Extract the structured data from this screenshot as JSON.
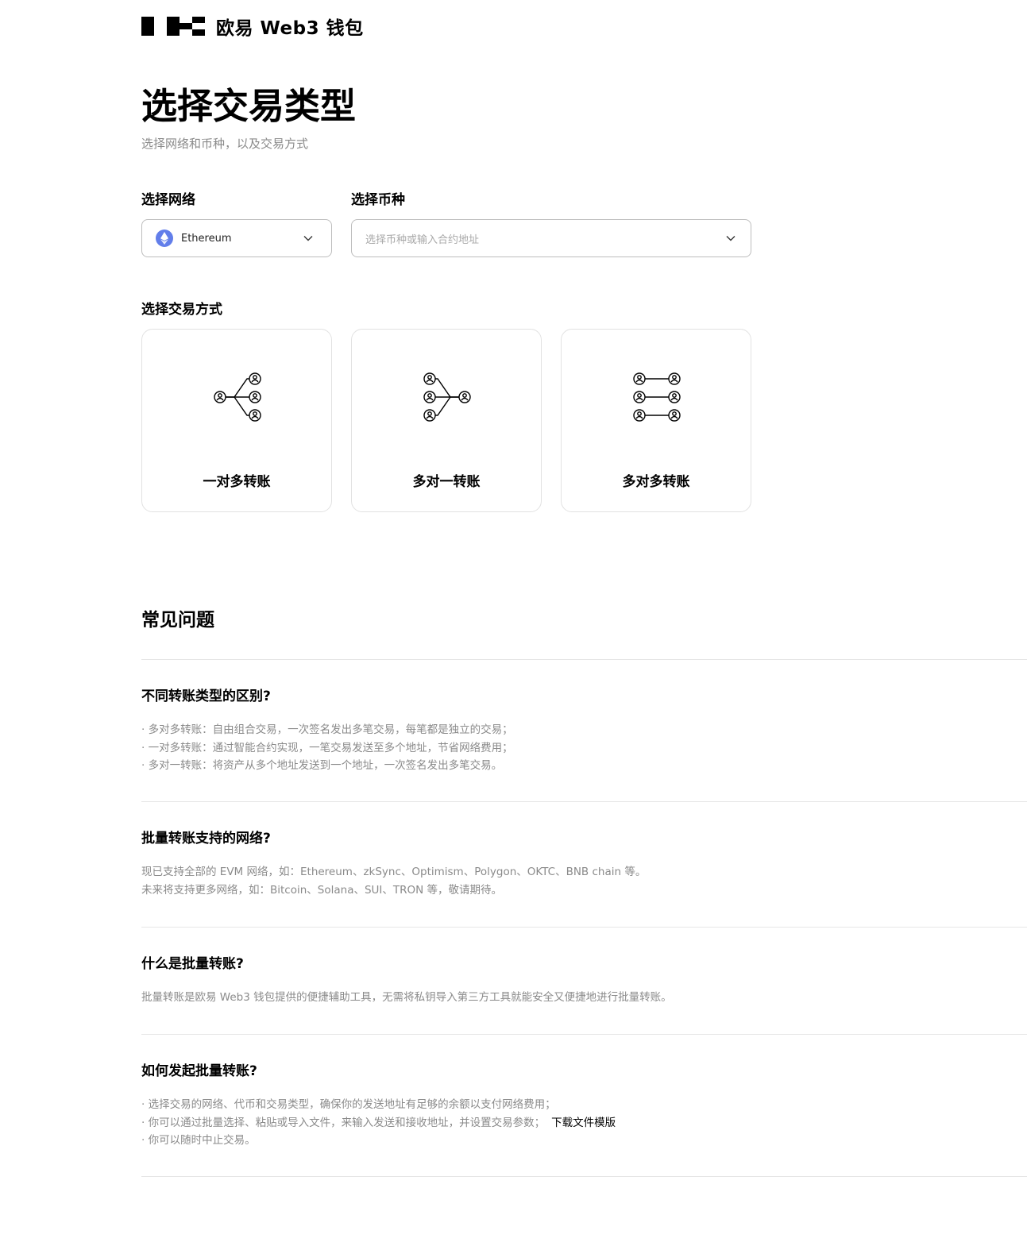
{
  "brand": {
    "name": "欧易 Web3 钱包",
    "logo": "okx-logo"
  },
  "page": {
    "title": "选择交易类型",
    "subtitle": "选择网络和币种，以及交易方式"
  },
  "network": {
    "label": "选择网络",
    "value": "Ethereum",
    "icon": "ethereum-icon"
  },
  "token": {
    "label": "选择币种",
    "placeholder": "选择币种或输入合约地址"
  },
  "mode": {
    "label": "选择交易方式",
    "options": [
      {
        "label": "一对多转账",
        "icon": "one-to-many-icon"
      },
      {
        "label": "多对一转账",
        "icon": "many-to-one-icon"
      },
      {
        "label": "多对多转账",
        "icon": "many-to-many-icon"
      }
    ]
  },
  "faq": {
    "title": "常见问题",
    "items": [
      {
        "q": "不同转账类型的区别?",
        "a": [
          "· 多对多转账：自由组合交易，一次签名发出多笔交易，每笔都是独立的交易；",
          "· 一对多转账：通过智能合约实现，一笔交易发送至多个地址，节省网络费用；",
          "· 多对一转账：将资产从多个地址发送到一个地址，一次签名发出多笔交易。"
        ]
      },
      {
        "q": "批量转账支持的网络?",
        "a": [
          "现已支持全部的 EVM 网络，如：Ethereum、zkSync、Optimism、Polygon、OKTC、BNB chain 等。",
          "未来将支持更多网络，如：Bitcoin、Solana、SUI、TRON 等，敬请期待。"
        ]
      },
      {
        "q": "什么是批量转账?",
        "a": [
          "批量转账是欧易 Web3 钱包提供的便捷辅助工具，无需将私钥导入第三方工具就能安全又便捷地进行批量转账。"
        ]
      },
      {
        "q": "如何发起批量转账?",
        "a": [
          "· 选择交易的网络、代币和交易类型，确保你的发送地址有足够的余额以支付网络费用；",
          "· 你可以通过批量选择、粘贴或导入文件，来输入发送和接收地址，并设置交易参数；",
          "· 你可以随时中止交易。"
        ],
        "link": "下载文件模版"
      }
    ]
  }
}
